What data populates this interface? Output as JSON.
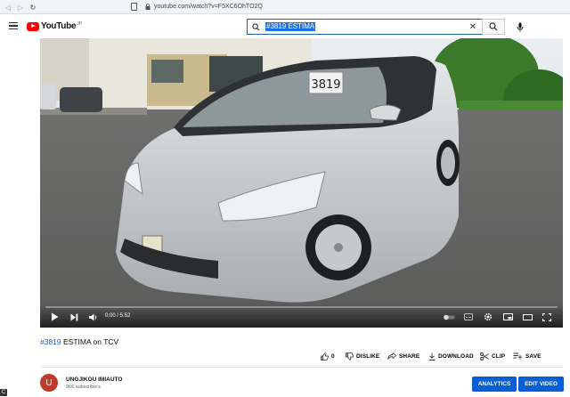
{
  "browser": {
    "url": "youtube.com/watch?v=F5XC6OhTO2Q",
    "icons": [
      "back-icon",
      "forward-icon",
      "reload-icon",
      "bookmark-icon",
      "lock-icon"
    ]
  },
  "header": {
    "logo_text": "YouTube",
    "logo_suffix": "JP",
    "search_value": "#3819 ESTIMA",
    "search_clear": "✕"
  },
  "player": {
    "plate_text": "3819",
    "time": "0:00 / 5:52",
    "progress": 0
  },
  "video": {
    "title_tag": "#3819",
    "title_rest": " ESTIMA on TCV"
  },
  "actions": {
    "like_count": "0",
    "dislike": "DISLIKE",
    "share": "SHARE",
    "download": "DOWNLOAD",
    "clip": "CLIP",
    "save": "SAVE"
  },
  "channel": {
    "avatar_letter": "U",
    "name": "UNGJIKOU IMIAUTO",
    "subscribers": "966 subscribers"
  },
  "buttons": {
    "analytics": "ANALYTICS",
    "edit_video": "EDIT VIDEO"
  },
  "corner_badge": "C",
  "colors": {
    "brand_red": "#ff0000",
    "accent_blue": "#065fd4",
    "car_silver": "#c8cbcf"
  }
}
